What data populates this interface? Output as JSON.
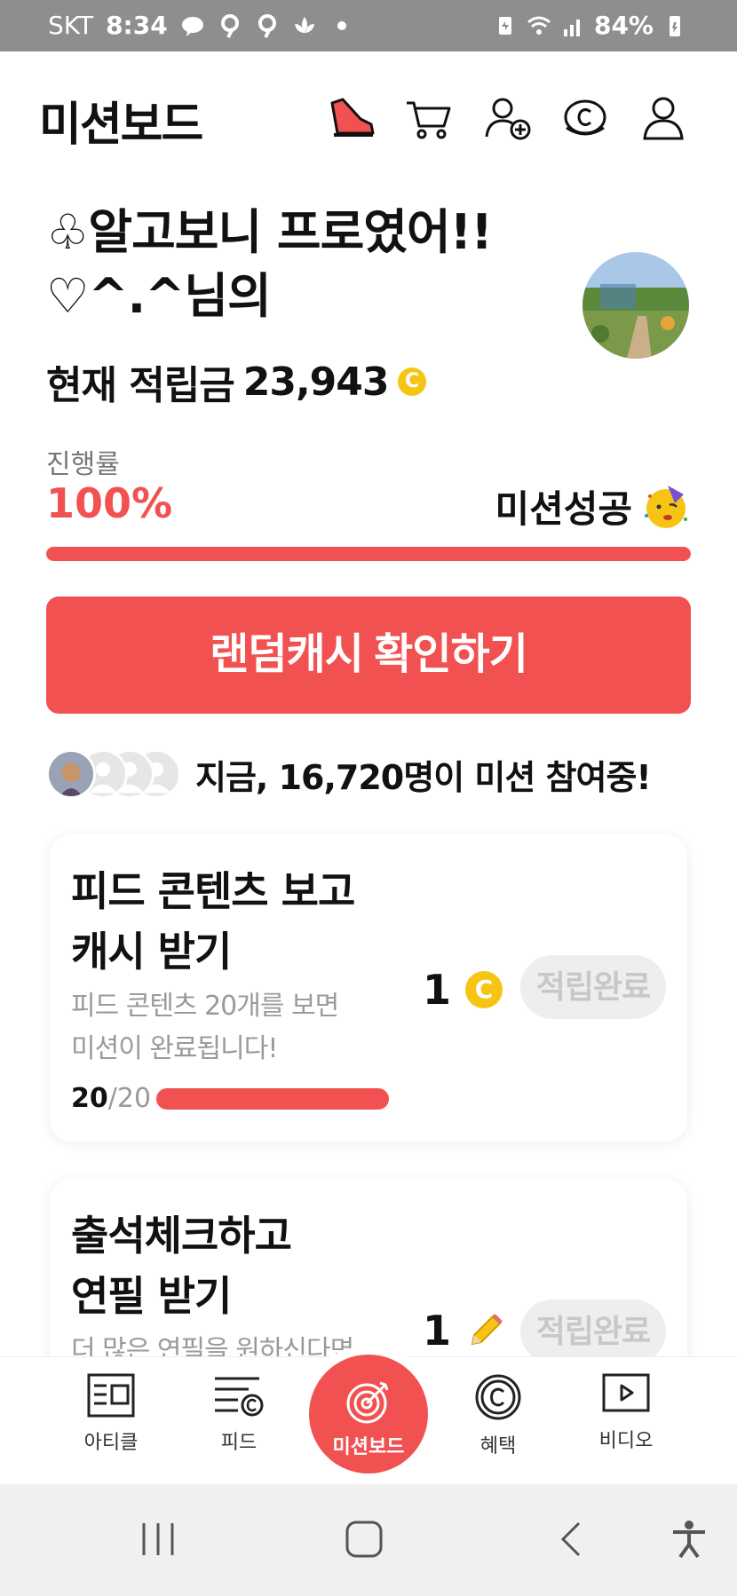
{
  "status_bar": {
    "carrier": "SKT",
    "time": "8:34",
    "battery": "84%",
    "icons": [
      "talk-icon",
      "q-icon",
      "q-icon",
      "lotus-icon",
      "dot-icon",
      "battery-saver-icon",
      "wifi-icon",
      "signal-icon",
      "battery-icon"
    ]
  },
  "header": {
    "title": "미션보드",
    "icons": [
      "sneaker-icon",
      "cart-icon",
      "add-friend-icon",
      "cash-coin-icon",
      "profile-icon"
    ]
  },
  "greeting": {
    "line1": "♧알고보니 프로였어!!",
    "line2": "♡^.^님의",
    "balance_label": "현재 적립금",
    "balance_value": "23,943",
    "coin_symbol": "C"
  },
  "progress": {
    "label": "진행률",
    "value": "100%",
    "fraction": 1.0,
    "status": "미션성공"
  },
  "random_cash_button": "랜덤캐시 확인하기",
  "participants": {
    "prefix": "지금,",
    "count": "16,720명",
    "suffix": "이 미션 참여중!"
  },
  "missions": [
    {
      "title_line1": "피드 콘텐츠 보고",
      "title_line2": "캐시 받기",
      "desc_line1": "피드 콘텐츠 20개를 보면",
      "desc_line2": "미션이 완료됩니다!",
      "progress_done": "20",
      "progress_total": "/20",
      "progress_fraction": 1.0,
      "reward": "1",
      "reward_icon": "cash-coin-icon",
      "status": "적립완료"
    },
    {
      "title_line1": "출석체크하고",
      "title_line2": "연필 받기",
      "desc_line1": "더 많은 연필을 원하신다면",
      "reward": "1",
      "reward_icon": "pencil-icon",
      "status": "적립완료"
    }
  ],
  "bottom_nav": {
    "article": "아티클",
    "feed": "피드",
    "missionboard": "미션보드",
    "benefits": "혜택",
    "video": "비디오"
  },
  "colors": {
    "accent": "#f15151",
    "coin": "#f6c514",
    "status_bar": "#8e8e8e",
    "pill_bg": "#eeeeee"
  }
}
